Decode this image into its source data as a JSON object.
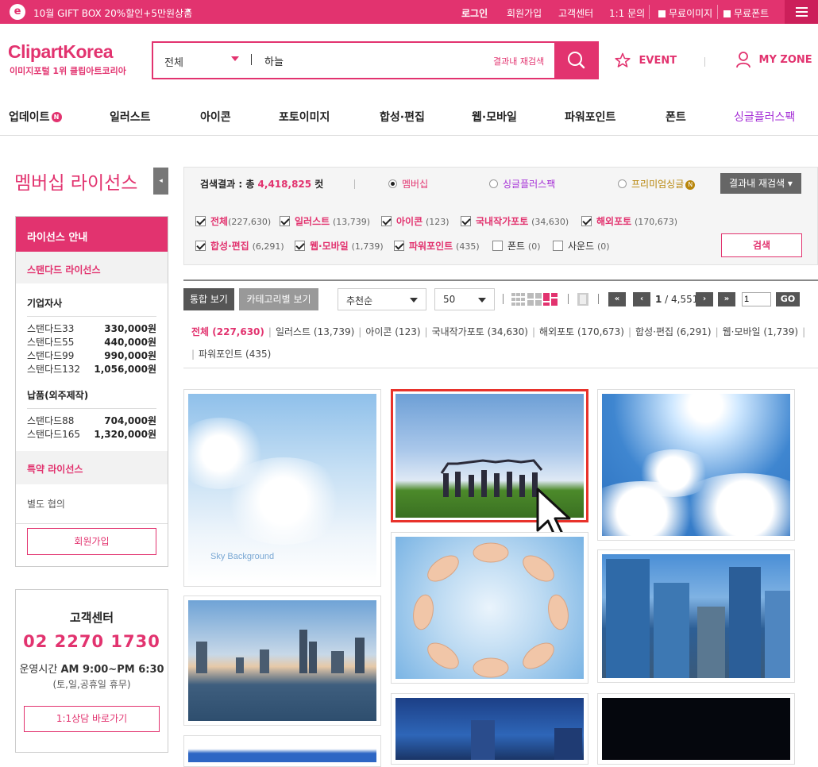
{
  "topbar": {
    "logo_letter": "e",
    "promo": "10월 GIFT BOX 20%할인+5만원상품",
    "promo_arrow": "▸",
    "links": [
      "로그인",
      "회원가입",
      "고객센터",
      "1:1 문의"
    ],
    "free_image": "무료이미지",
    "free_font": "무료폰트"
  },
  "header": {
    "logo": "ClipartKorea",
    "logo_sub": "이미지포털 1위 클립아트코리아",
    "search_scope": "전체",
    "search_value": "하늘",
    "research_label": "결과내 재검색",
    "event_label": "EVENT",
    "myzone_label": "MY ZONE"
  },
  "nav": {
    "items": [
      "업데이트",
      "일러스트",
      "아이콘",
      "포토이미지",
      "합성·편집",
      "웹·모바일",
      "파워포인트",
      "폰트",
      "싱글플러스팩"
    ],
    "new_badge": "N"
  },
  "sidebar": {
    "title": "멤버십 라이선스",
    "toggle": "◂",
    "license_head": "라이선스 안내",
    "standard": "스탠다드 라이선스",
    "group1_title": "기업자사",
    "group1": [
      {
        "name": "스탠다드33",
        "price": "330,000원"
      },
      {
        "name": "스탠다드55",
        "price": "440,000원"
      },
      {
        "name": "스탠다드99",
        "price": "990,000원"
      },
      {
        "name": "스탠다드132",
        "price": "1,056,000원"
      }
    ],
    "group2_title": "납품(외주제작)",
    "group2": [
      {
        "name": "스탠다드88",
        "price": "704,000원"
      },
      {
        "name": "스탠다드165",
        "price": "1,320,000원"
      }
    ],
    "special": "특약 라이선스",
    "other": "별도 협의",
    "join": "회원가입",
    "cs_title": "고객센터",
    "cs_phone": "02 2270 1730",
    "cs_hours_prefix": "운영시간 ",
    "cs_hours": "AM 9:00~PM 6:30",
    "cs_holiday": "(토,일,공휴일 휴무)",
    "cs_button": "1:1상담 바로가기"
  },
  "filter": {
    "count_label": "검색결과 : 총 ",
    "count_value": "4,418,825",
    "count_unit": " 컷",
    "radios": [
      "멤버십",
      "싱글플러스팩",
      "프리미엄싱글"
    ],
    "premium_badge": "N",
    "research_button": "결과내 재검색 ▾",
    "checks": [
      {
        "label": "전체",
        "count": "(227,630)",
        "checked": true
      },
      {
        "label": "일러스트",
        "count": "(13,739)",
        "checked": true
      },
      {
        "label": "아이콘",
        "count": "(123)",
        "checked": true
      },
      {
        "label": "국내작가포토",
        "count": "(34,630)",
        "checked": true
      },
      {
        "label": "해외포토",
        "count": "(170,673)",
        "checked": true
      },
      {
        "label": "합성·편집",
        "count": "(6,291)",
        "checked": true
      },
      {
        "label": "웹·모바일",
        "count": "(1,739)",
        "checked": true
      },
      {
        "label": "파워포인트",
        "count": "(435)",
        "checked": true
      },
      {
        "label": "폰트",
        "count": "(0)",
        "checked": false
      },
      {
        "label": "사운드",
        "count": "(0)",
        "checked": false
      }
    ],
    "search_button": "검색"
  },
  "toolbar": {
    "view_all": "통합 보기",
    "view_category": "카테고리별 보기",
    "sort": "추천순",
    "per_page": "50",
    "page_current": "1",
    "page_sep": " / ",
    "page_total": "4,551",
    "page_input": "1",
    "go": "GO",
    "first": "«",
    "prev": "‹",
    "next": "›",
    "last": "»"
  },
  "categories": {
    "active": "전체 (227,630)",
    "items": [
      "일러스트 (13,739)",
      "아이콘 (123)",
      "국내작가포토 (34,630)",
      "해외포토 (170,673)",
      "합성·편집 (6,291)",
      "웹·모바일 (1,739)",
      "파워포인트 (435)"
    ]
  },
  "results": {
    "sky_caption": "Sky Background"
  },
  "colors": {
    "brand": "#e2336f",
    "premium": "#b8860b",
    "single": "#a52fd6",
    "selected_border": "#e8322b"
  }
}
